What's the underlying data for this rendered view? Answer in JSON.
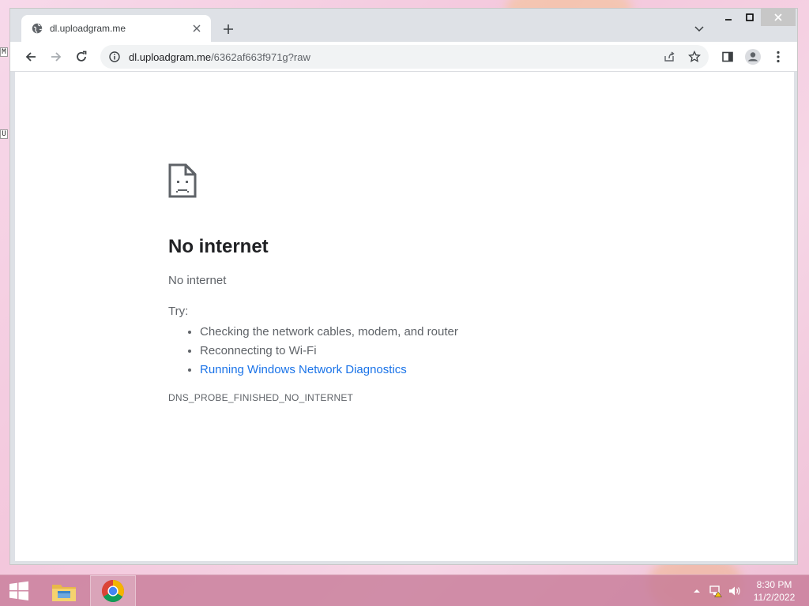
{
  "browser": {
    "tab": {
      "title": "dl.uploadgram.me",
      "favicon": "globe-icon"
    },
    "address": {
      "host": "dl.uploadgram.me",
      "path": "/6362af663f971g?raw"
    }
  },
  "error_page": {
    "heading": "No internet",
    "subheading": "No internet",
    "try_label": "Try:",
    "suggestions": [
      "Checking the network cables, modem, and router",
      "Reconnecting to Wi-Fi"
    ],
    "diagnostics_link": "Running Windows Network Diagnostics",
    "error_code": "DNS_PROBE_FINISHED_NO_INTERNET"
  },
  "taskbar": {
    "time": "8:30 PM",
    "date": "11/2/2022"
  },
  "colors": {
    "link": "#1a73e8",
    "taskbar": "#c5788f",
    "tabstrip": "#dee1e6"
  }
}
